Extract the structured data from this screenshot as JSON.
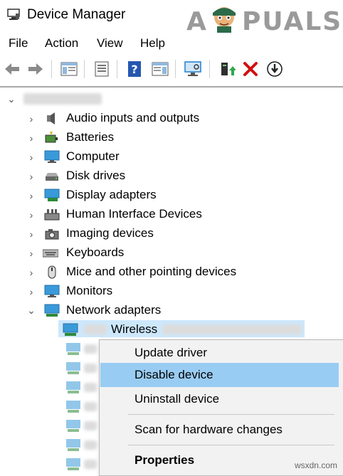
{
  "window": {
    "title": "Device Manager"
  },
  "logo": {
    "text_left": "A",
    "text_right": "PUALS"
  },
  "menu": [
    "File",
    "Action",
    "View",
    "Help"
  ],
  "toolbar": {
    "icons": [
      "back-arrow-icon",
      "forward-arrow-icon",
      "console-tree-icon",
      "properties-sheet-icon",
      "help-icon",
      "action-pane-icon",
      "scan-hardware-icon",
      "update-driver-icon",
      "uninstall-icon",
      "disable-icon"
    ]
  },
  "tree": {
    "root_label": "",
    "categories": [
      {
        "label": "Audio inputs and outputs",
        "icon": "speaker-icon",
        "expanded": false
      },
      {
        "label": "Batteries",
        "icon": "battery-icon",
        "expanded": false
      },
      {
        "label": "Computer",
        "icon": "monitor-icon",
        "expanded": false
      },
      {
        "label": "Disk drives",
        "icon": "disk-drive-icon",
        "expanded": false
      },
      {
        "label": "Display adapters",
        "icon": "display-adapter-icon",
        "expanded": false
      },
      {
        "label": "Human Interface Devices",
        "icon": "hid-icon",
        "expanded": false
      },
      {
        "label": "Imaging devices",
        "icon": "camera-icon",
        "expanded": false
      },
      {
        "label": "Keyboards",
        "icon": "keyboard-icon",
        "expanded": false
      },
      {
        "label": "Mice and other pointing devices",
        "icon": "mouse-icon",
        "expanded": false
      },
      {
        "label": "Monitors",
        "icon": "monitor-icon",
        "expanded": false
      },
      {
        "label": "Network adapters",
        "icon": "network-adapter-icon",
        "expanded": true
      }
    ],
    "selected_child": {
      "label": "Wireless"
    }
  },
  "context_menu": {
    "items": [
      "Update driver",
      "Disable device",
      "Uninstall device",
      "Scan for hardware changes",
      "Properties"
    ],
    "highlighted": "Disable device"
  },
  "watermark": "wsxdn.com",
  "colors": {
    "selection": "#cde8fb",
    "menu_highlight": "#99ccf3",
    "accent_red": "#d01010",
    "accent_blue": "#1f7ed0"
  }
}
